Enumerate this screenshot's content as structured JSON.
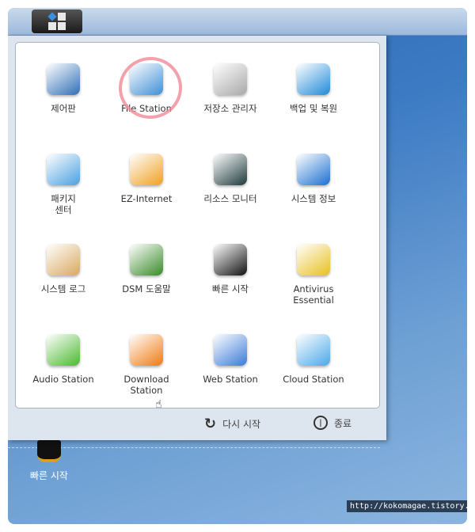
{
  "apps": [
    {
      "label": "제어판",
      "icon": "control-panel-icon",
      "color": "#2f6fb5"
    },
    {
      "label": "File Station",
      "icon": "file-station-icon",
      "color": "#3f8fd6"
    },
    {
      "label": "저장소 관리자",
      "icon": "storage-manager-icon",
      "color": "#a8a8a8"
    },
    {
      "label": "백업 및 복원",
      "icon": "backup-restore-icon",
      "color": "#1e8ad8"
    },
    {
      "label": "패키지\n센터",
      "icon": "package-center-icon",
      "color": "#4aa0e0"
    },
    {
      "label": "EZ-Internet",
      "icon": "ez-internet-icon",
      "color": "#f0a020"
    },
    {
      "label": "리소스 모니터",
      "icon": "resource-monitor-icon",
      "color": "#1e3a3a"
    },
    {
      "label": "시스템 정보",
      "icon": "system-info-icon",
      "color": "#1a6fd0"
    },
    {
      "label": "시스템 로그",
      "icon": "system-log-icon",
      "color": "#d9a860"
    },
    {
      "label": "DSM 도움말",
      "icon": "dsm-help-icon",
      "color": "#3a8a2a"
    },
    {
      "label": "빠른 시작",
      "icon": "quick-start-icon",
      "color": "#111111"
    },
    {
      "label": "Antivirus\nEssential",
      "icon": "antivirus-icon",
      "color": "#e8c020"
    },
    {
      "label": "Audio Station",
      "icon": "audio-station-icon",
      "color": "#4cb830"
    },
    {
      "label": "Download\nStation",
      "icon": "download-station-icon",
      "color": "#f07a10"
    },
    {
      "label": "Web Station",
      "icon": "web-station-icon",
      "color": "#3a7ad8"
    },
    {
      "label": "Cloud Station",
      "icon": "cloud-station-icon",
      "color": "#4aa8e8"
    }
  ],
  "footer": {
    "restart": "다시 시작",
    "shutdown": "종료"
  },
  "desktop": {
    "shortcut": "빠른 시작"
  },
  "watermark": "http://kokomagae.tistory.com"
}
